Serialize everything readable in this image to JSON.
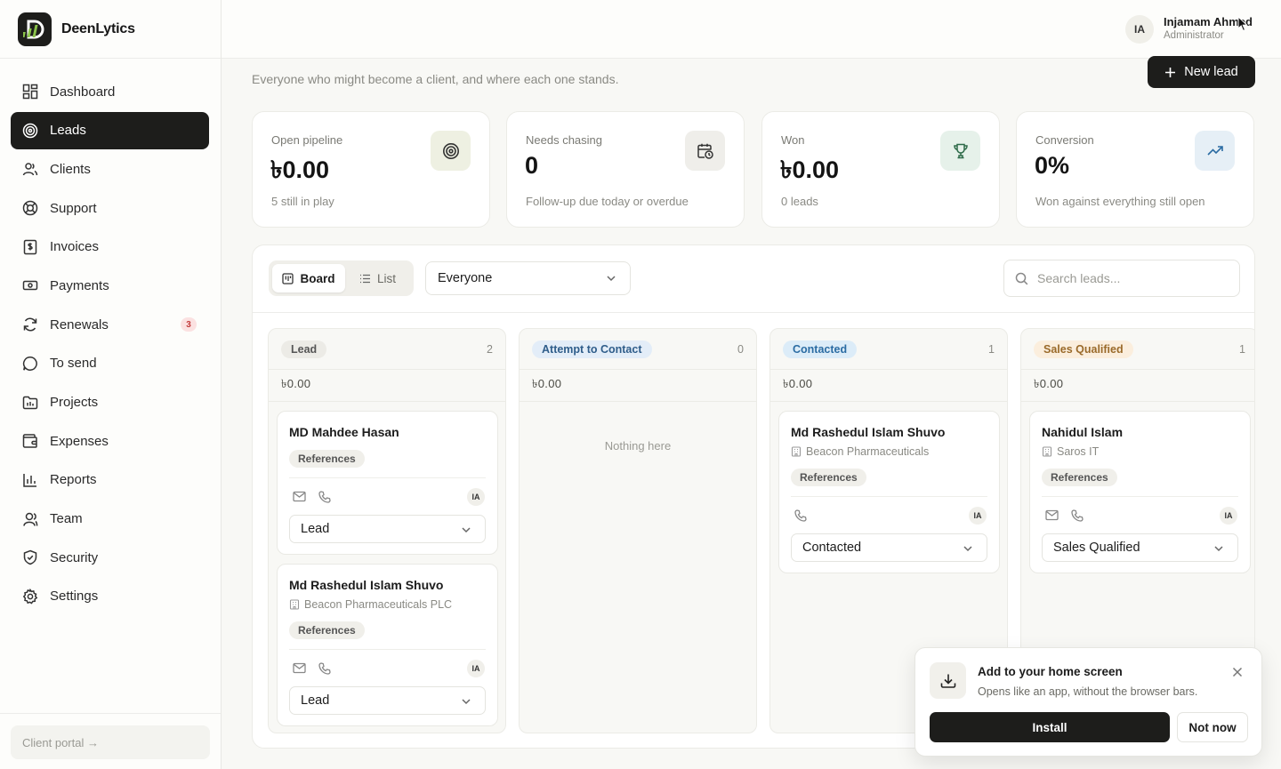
{
  "brand": {
    "name": "DeenLytics",
    "logo_color": "#1d1d1b",
    "accent": "#8bc34a"
  },
  "sidebar": {
    "items": [
      {
        "label": "Dashboard",
        "icon": "dashboard-icon"
      },
      {
        "label": "Leads",
        "icon": "target-icon",
        "active": true
      },
      {
        "label": "Clients",
        "icon": "users-icon"
      },
      {
        "label": "Support",
        "icon": "lifebuoy-icon"
      },
      {
        "label": "Invoices",
        "icon": "invoice-icon"
      },
      {
        "label": "Payments",
        "icon": "banknote-icon"
      },
      {
        "label": "Renewals",
        "icon": "refresh-icon",
        "badge": "3"
      },
      {
        "label": "To send",
        "icon": "message-icon"
      },
      {
        "label": "Projects",
        "icon": "folder-icon"
      },
      {
        "label": "Expenses",
        "icon": "wallet-icon"
      },
      {
        "label": "Reports",
        "icon": "bar-chart-icon"
      },
      {
        "label": "Team",
        "icon": "team-icon"
      },
      {
        "label": "Security",
        "icon": "shield-icon"
      },
      {
        "label": "Settings",
        "icon": "gear-icon"
      }
    ],
    "footer_link": "Client portal →"
  },
  "header": {
    "user_initials": "IA",
    "user_name": "Injamam Ahmed",
    "user_role": "Administrator"
  },
  "page": {
    "subtitle": "Everyone who might become a client, and where each one stands.",
    "new_lead_label": "New lead"
  },
  "stats": [
    {
      "label": "Open pipeline",
      "value": "৳0.00",
      "sub": "5 still in play",
      "icon": "target-icon",
      "icon_bg": "#eef0e2"
    },
    {
      "label": "Needs chasing",
      "value": "0",
      "sub": "Follow-up due today or overdue",
      "icon": "calendar-clock-icon",
      "icon_bg": "#efeeea"
    },
    {
      "label": "Won",
      "value": "৳0.00",
      "sub": "0 leads",
      "icon": "trophy-icon",
      "icon_bg": "#e6f1ea"
    },
    {
      "label": "Conversion",
      "value": "0%",
      "sub": "Won against everything still open",
      "icon": "trending-up-icon",
      "icon_bg": "#e6eff6"
    }
  ],
  "toolbar": {
    "view_board": "Board",
    "view_list": "List",
    "owner_filter": "Everyone",
    "search_placeholder": "Search leads..."
  },
  "columns": [
    {
      "title": "Lead",
      "count": "2",
      "total": "৳0.00",
      "pill_bg": "#ecebe6",
      "pill_color": "#555555",
      "cards": [
        {
          "name": "MD Mahdee Hasan",
          "org": "",
          "tag": "References",
          "avatar": "IA",
          "has_email": true,
          "has_phone": true,
          "status": "Lead"
        },
        {
          "name": "Md Rashedul Islam Shuvo",
          "org": "Beacon Pharmaceuticals PLC",
          "tag": "References",
          "avatar": "IA",
          "has_email": true,
          "has_phone": true,
          "status": "Lead"
        }
      ]
    },
    {
      "title": "Attempt to Contact",
      "count": "0",
      "total": "৳0.00",
      "pill_bg": "#e3edf8",
      "pill_color": "#2f5d8a",
      "empty_text": "Nothing here",
      "cards": []
    },
    {
      "title": "Contacted",
      "count": "1",
      "total": "৳0.00",
      "pill_bg": "#dcecf8",
      "pill_color": "#2b6ca3",
      "cards": [
        {
          "name": "Md Rashedul Islam Shuvo",
          "org": "Beacon Pharmaceuticals",
          "tag": "References",
          "avatar": "IA",
          "has_email": false,
          "has_phone": true,
          "status": "Contacted"
        }
      ]
    },
    {
      "title": "Sales Qualified",
      "count": "1",
      "total": "৳0.00",
      "pill_bg": "#fbeedd",
      "pill_color": "#9a6a2a",
      "cards": [
        {
          "name": "Nahidul Islam",
          "org": "Saros IT",
          "tag": "References",
          "avatar": "IA",
          "has_email": true,
          "has_phone": true,
          "status": "Sales Qualified"
        }
      ]
    }
  ],
  "install_prompt": {
    "title": "Add to your home screen",
    "subtitle": "Opens like an app, without the browser bars.",
    "install_label": "Install",
    "dismiss_label": "Not now"
  }
}
